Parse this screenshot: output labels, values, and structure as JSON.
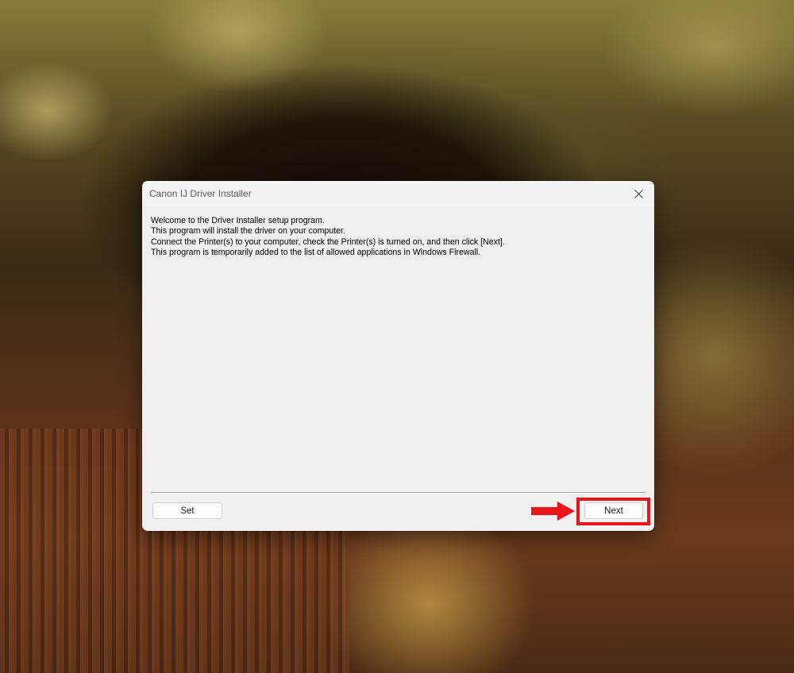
{
  "window": {
    "title": "Canon IJ Driver Installer"
  },
  "content": {
    "lines": [
      "Welcome to the Driver Installer setup program.",
      "This program will install the driver on your computer.",
      "Connect the Printer(s) to your computer, check the Printer(s) is turned on, and then click [Next].",
      "This program is temporarily added to the list of allowed applications in Windows Firewall."
    ]
  },
  "buttons": {
    "set_label": "Set",
    "next_label": "Next"
  },
  "annotation": {
    "color": "#e8161b",
    "icon": "right-arrow-icon"
  }
}
